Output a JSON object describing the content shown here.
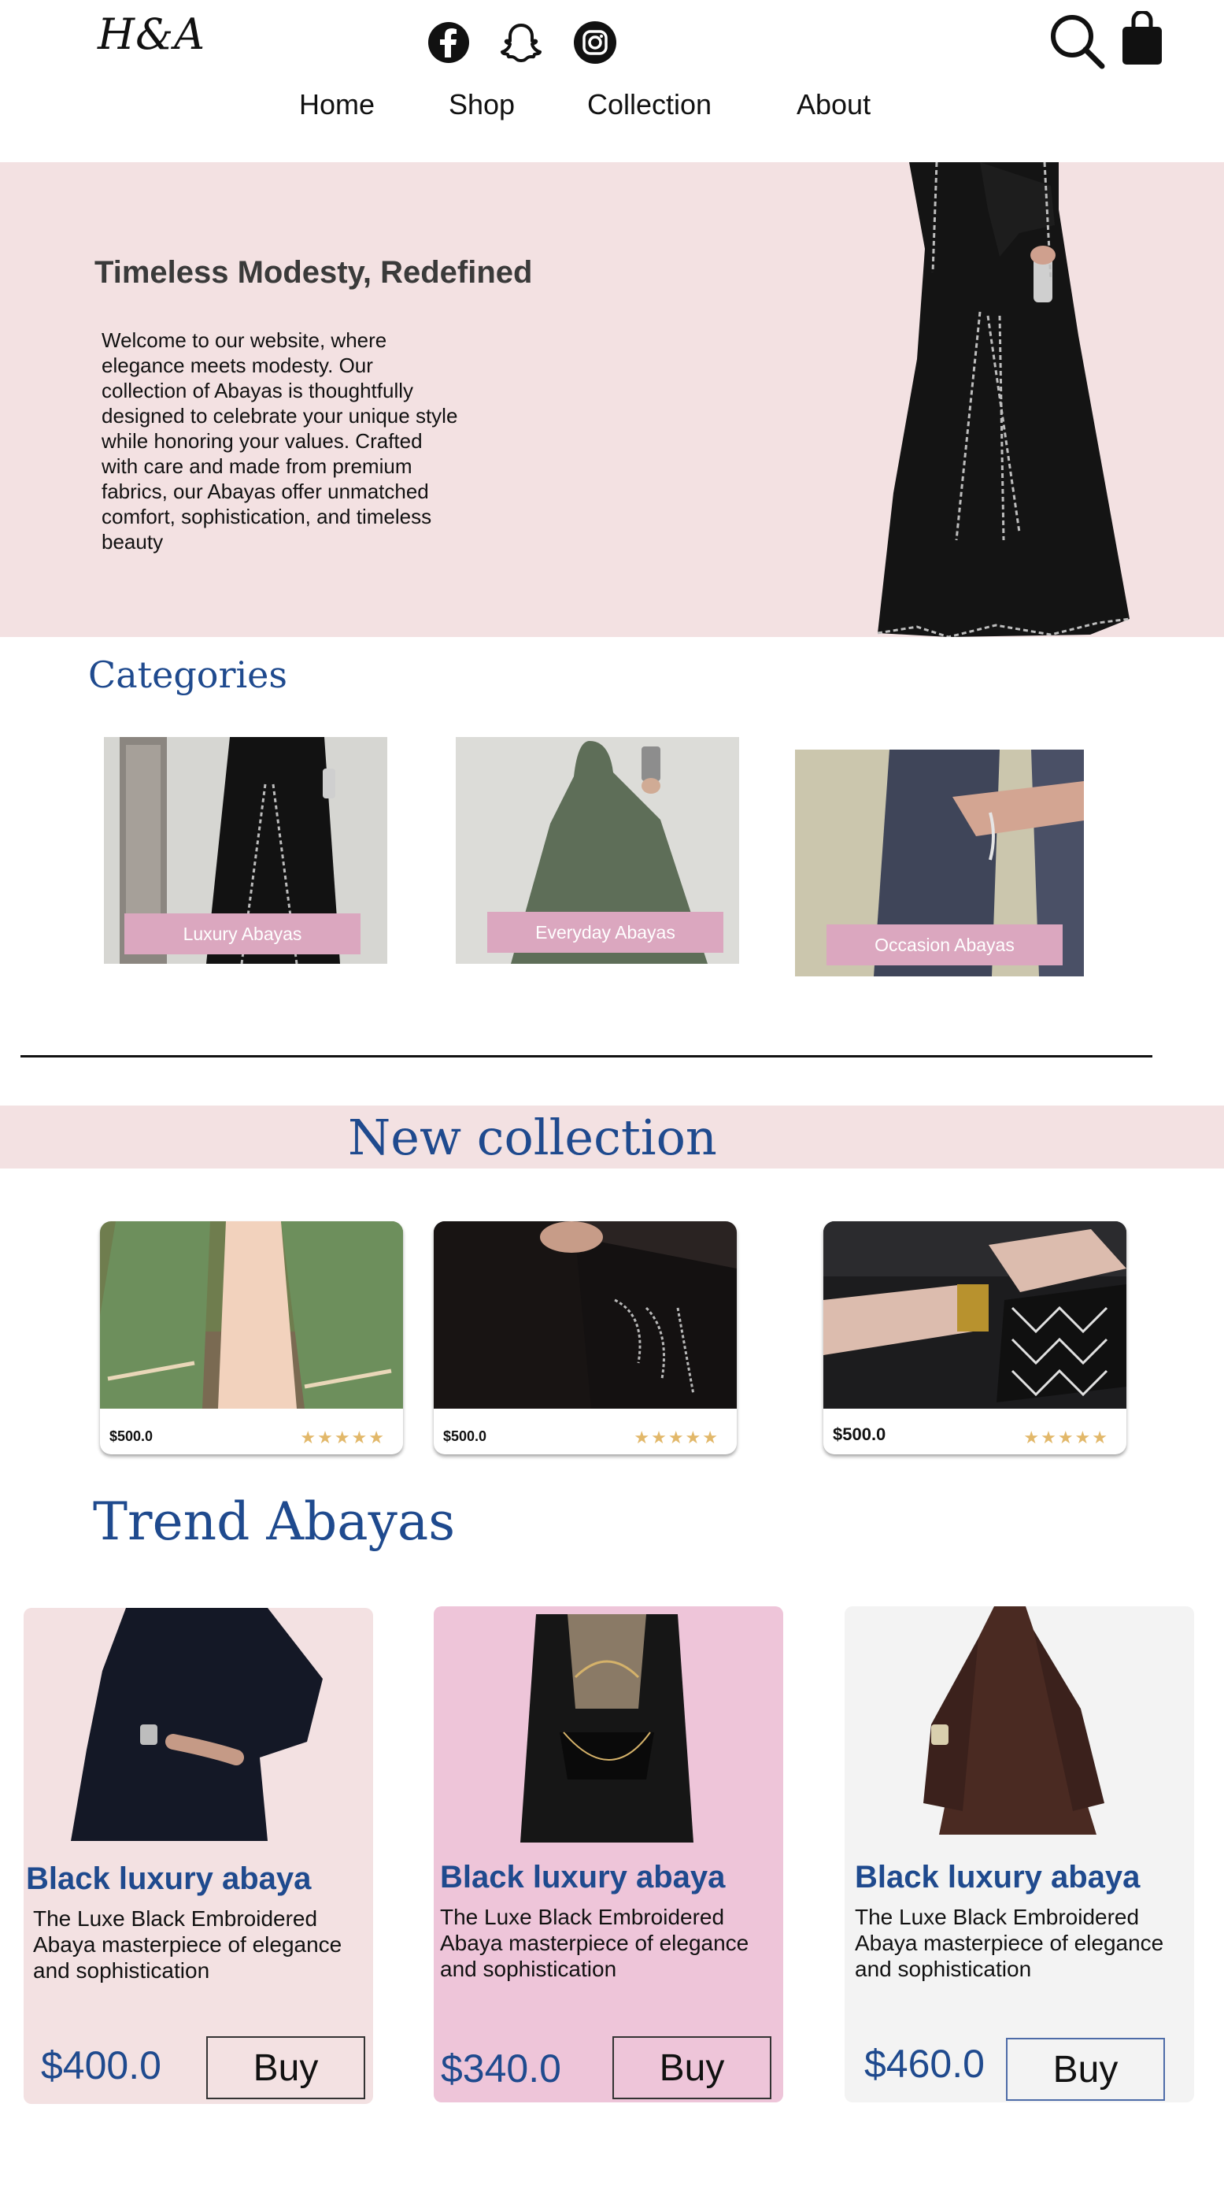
{
  "header": {
    "logo": "H&A",
    "nav": [
      "Home",
      "Shop",
      "Collection",
      "About"
    ]
  },
  "icons": {
    "social": [
      "facebook-icon",
      "snapchat-icon",
      "instagram-icon"
    ],
    "actions": [
      "search-icon",
      "shopping-bag-icon"
    ]
  },
  "hero": {
    "title": "Timeless Modesty, Redefined",
    "text": "Welcome to our website, where elegance meets modesty. Our collection of Abayas is thoughtfully designed to celebrate your unique style while honoring your values. Crafted with care and made from premium fabrics, our Abayas offer unmatched comfort, sophistication, and timeless beauty"
  },
  "categories": {
    "title": "Categories",
    "items": [
      {
        "label": "Luxury Abayas"
      },
      {
        "label": "Everyday Abayas"
      },
      {
        "label": "Occasion  Abayas"
      }
    ]
  },
  "new_collection": {
    "title": "New collection",
    "items": [
      {
        "price": "$500.0",
        "rating": 5
      },
      {
        "price": "$500.0",
        "rating": 5
      },
      {
        "price": "$500.0",
        "rating": 5
      }
    ]
  },
  "trend": {
    "title": "Trend Abayas",
    "items": [
      {
        "title": "Black luxury abaya",
        "desc": " The Luxe Black Embroidered Abaya  masterpiece of elegance and sophistication",
        "price": "$400.0",
        "buy": "Buy"
      },
      {
        "title": "Black luxury abaya",
        "desc": " The Luxe Black Embroidered Abaya  masterpiece of elegance and sophistication",
        "price": "$340.0",
        "buy": "Buy"
      },
      {
        "title": "Black luxury abaya",
        "desc": " The Luxe Black Embroidered Abaya  masterpiece of elegance and sophistication",
        "price": "$460.0",
        "buy": "Buy"
      }
    ]
  },
  "colors": {
    "accent_blue": "#1f4a8e",
    "hero_pink": "#f3e1e2",
    "label_pink": "#dba7bf",
    "card_pink": "#eec5d9",
    "card_gray": "#f3f3f3",
    "star_gold": "#e2b86a"
  }
}
